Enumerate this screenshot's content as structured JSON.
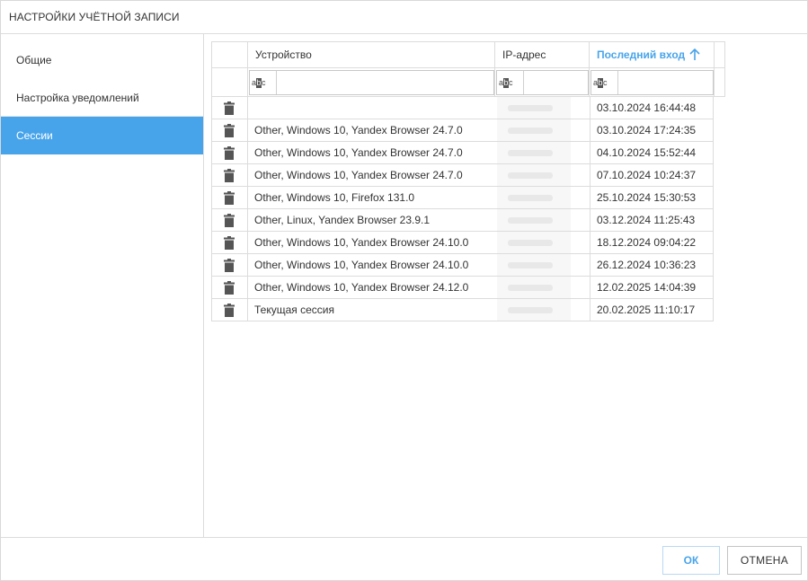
{
  "dialog": {
    "title": "НАСТРОЙКИ УЧЁТНОЙ ЗАПИСИ"
  },
  "sidebar": {
    "items": [
      {
        "label": "Общие",
        "active": false
      },
      {
        "label": "Настройка уведомлений",
        "active": false
      },
      {
        "label": "Сессии",
        "active": true
      }
    ]
  },
  "grid": {
    "columns": [
      {
        "label": ""
      },
      {
        "label": "Устройство"
      },
      {
        "label": "IP-адрес"
      },
      {
        "label": "Последний вход",
        "sorted": "asc"
      },
      {
        "label": ""
      }
    ],
    "filter_icon": "abc-filter-icon",
    "rows": [
      {
        "device": "",
        "last_login": "03.10.2024 16:44:48"
      },
      {
        "device": "Other, Windows 10, Yandex Browser 24.7.0",
        "last_login": "03.10.2024 17:24:35"
      },
      {
        "device": "Other, Windows 10, Yandex Browser 24.7.0",
        "last_login": "04.10.2024 15:52:44"
      },
      {
        "device": "Other, Windows 10, Yandex Browser 24.7.0",
        "last_login": "07.10.2024 10:24:37"
      },
      {
        "device": "Other, Windows 10, Firefox 131.0",
        "last_login": "25.10.2024 15:30:53"
      },
      {
        "device": "Other, Linux, Yandex Browser 23.9.1",
        "last_login": "03.12.2024 11:25:43"
      },
      {
        "device": "Other, Windows 10, Yandex Browser 24.10.0",
        "last_login": "18.12.2024 09:04:22"
      },
      {
        "device": "Other, Windows 10, Yandex Browser 24.10.0",
        "last_login": "26.12.2024 10:36:23"
      },
      {
        "device": "Other, Windows 10, Yandex Browser 24.12.0",
        "last_login": "12.02.2025 14:04:39"
      },
      {
        "device": "Текущая сессия",
        "last_login": "20.02.2025 11:10:17"
      }
    ]
  },
  "footer": {
    "ok_label": "ОК",
    "cancel_label": "ОТМЕНА"
  },
  "colors": {
    "accent": "#48a4ea",
    "border": "#dcdcdc",
    "text": "#333333"
  }
}
